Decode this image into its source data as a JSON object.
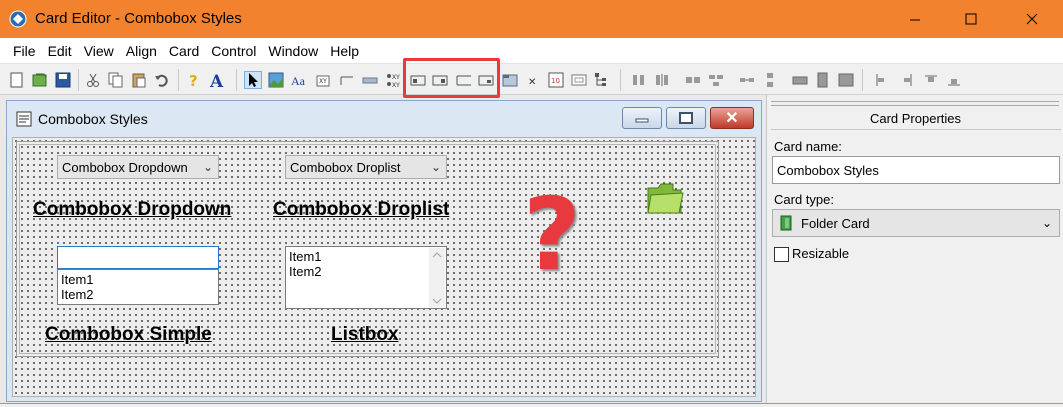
{
  "app": {
    "title": "Card Editor - Combobox Styles",
    "accent": "#f2822e"
  },
  "menu": [
    "File",
    "Edit",
    "View",
    "Align",
    "Card",
    "Control",
    "Window",
    "Help"
  ],
  "toolbar": {
    "icons": [
      "new-card-icon",
      "open-icon",
      "save-icon",
      "cut-icon",
      "copy-icon",
      "paste-icon",
      "undo-icon",
      "help-icon",
      "font-icon",
      "pointer-icon",
      "image-icon",
      "label-icon",
      "xy-icon",
      "line-icon",
      "rectangle-icon",
      "xy-pair-icon",
      "frame-icon-1",
      "frame-icon-2",
      "frame-icon-3",
      "frame-icon-4",
      "panel-icon",
      "checkbox-icon",
      "listbox-icon",
      "combobox-icon",
      "tree-icon",
      "align-icon-1",
      "align-icon-2",
      "align-icon-3",
      "align-icon-4",
      "align-icon-5",
      "align-icon-6",
      "align-icon-7",
      "align-icon-8",
      "align-icon-9",
      "align-icon-10",
      "align-icon-11"
    ]
  },
  "child_window": {
    "title": "Combobox Styles",
    "close_glyph": "✕"
  },
  "card": {
    "dropdown_combo": "Combobox Dropdown",
    "droplist_combo": "Combobox Droplist",
    "heading_dropdown": "Combobox Dropdown",
    "heading_droplist": "Combobox Droplist",
    "simple_items": [
      "Item1",
      "Item2"
    ],
    "listbox_items": [
      "Item1",
      "Item2"
    ],
    "heading_simple": "Combobox Simple",
    "heading_listbox": "Listbox",
    "question_mark": "?"
  },
  "properties": {
    "title": "Card Properties",
    "card_name_label": "Card name:",
    "card_name_value": "Combobox Styles",
    "card_type_label": "Card type:",
    "card_type_value": "Folder Card",
    "resizable_label": "Resizable",
    "resizable_checked": false
  }
}
